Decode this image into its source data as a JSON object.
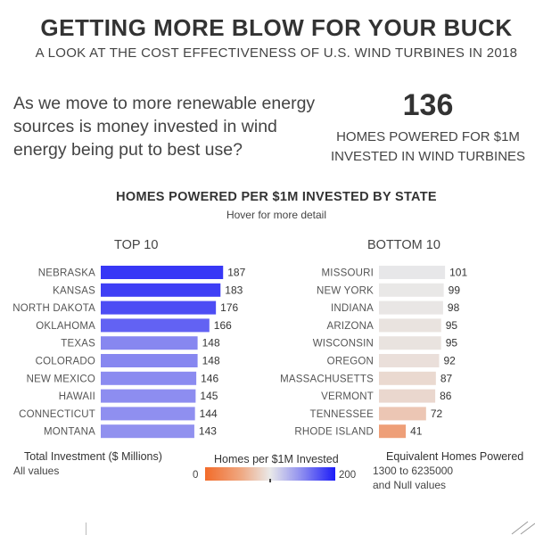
{
  "header": {
    "title": "GETTING MORE BLOW FOR YOUR BUCK",
    "subtitle": "A LOOK AT THE COST EFFECTIVENESS OF U.S. WIND TURBINES IN 2018"
  },
  "intro": {
    "text": "As we move to more renewable energy sources is money invested in wind energy being put to best use?"
  },
  "kpi": {
    "value": "136",
    "label_line1": "HOMES POWERED FOR $1M",
    "label_line2": "INVESTED IN WIND TURBINES"
  },
  "chart_data": {
    "type": "bar",
    "orientation": "horizontal",
    "title": "HOMES POWERED PER $1M INVESTED BY STATE",
    "subtitle": "Hover for more detail",
    "color_scale": {
      "min": 0,
      "max": 200,
      "low_color": "#f26b2a",
      "mid_color": "#e9e9e9",
      "high_color": "#1c1cf8"
    },
    "panels": [
      {
        "title": "TOP 10",
        "categories": [
          "NEBRASKA",
          "KANSAS",
          "NORTH DAKOTA",
          "OKLAHOMA",
          "TEXAS",
          "COLORADO",
          "NEW MEXICO",
          "HAWAII",
          "CONNECTICUT",
          "MONTANA"
        ],
        "values": [
          187,
          183,
          176,
          166,
          148,
          148,
          146,
          145,
          144,
          143
        ]
      },
      {
        "title": "BOTTOM 10",
        "categories": [
          "MISSOURI",
          "NEW YORK",
          "INDIANA",
          "ARIZONA",
          "WISCONSIN",
          "OREGON",
          "MASSACHUSETTS",
          "VERMONT",
          "TENNESSEE",
          "RHODE ISLAND"
        ],
        "values": [
          101,
          99,
          98,
          95,
          95,
          92,
          87,
          86,
          72,
          41
        ]
      }
    ]
  },
  "legends": {
    "investment_title": "Total Investment ($ Millions)",
    "investment_value": "All values",
    "color_title": "Homes per $1M Invested",
    "color_min": "0",
    "color_max": "200",
    "homes_title": "Equivalent Homes Powered",
    "homes_range": "1300 to 6235000",
    "homes_null": "and Null values"
  }
}
